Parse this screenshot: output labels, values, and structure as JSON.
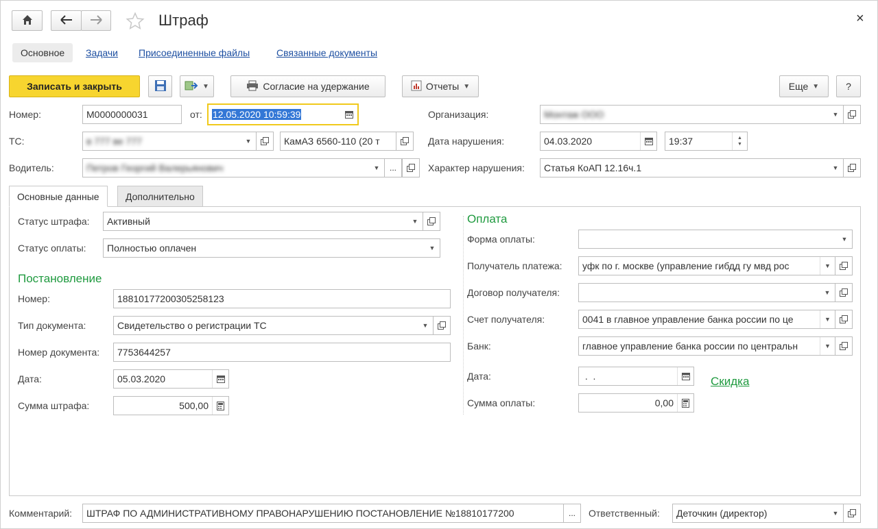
{
  "window": {
    "title": "Штраф",
    "close_glyph": "×"
  },
  "nav": {
    "home_icon": "home-icon",
    "back_icon": "arrow-left-icon",
    "forward_icon": "arrow-right-icon",
    "star_icon": "star-icon"
  },
  "tabs": [
    {
      "label": "Основное",
      "active": true
    },
    {
      "label": "Задачи"
    },
    {
      "label": "Присоединенные файлы"
    },
    {
      "label": "Связанные документы"
    }
  ],
  "toolbar": {
    "save_close_label": "Записать и закрыть",
    "consent_label": "Согласие на удержание",
    "reports_label": "Отчеты",
    "more_label": "Еще",
    "help_label": "?"
  },
  "header": {
    "number_label": "Номер:",
    "number_value": "М0000000031",
    "from_label": "от:",
    "from_value": "12.05.2020 10:59:39",
    "ts_label": "ТС:",
    "ts_value": "в 777 ве 777",
    "ts_model": "КамАЗ 6560-110 (20 т",
    "driver_label": "Водитель:",
    "driver_value": "Петров Георгий Валерьянович",
    "org_label": "Организация:",
    "org_value": "Монтаж ООО",
    "violation_date_label": "Дата нарушения:",
    "violation_date": "04.03.2020",
    "violation_time": "19:37",
    "violation_kind_label": "Характер нарушения:",
    "violation_kind": "Статья КоАП 12.16ч.1"
  },
  "inner_tabs": [
    {
      "label": "Основные данные",
      "active": true
    },
    {
      "label": "Дополнительно"
    }
  ],
  "left": {
    "fine_status_label": "Статус штрафа:",
    "fine_status": "Активный",
    "pay_status_label": "Статус оплаты:",
    "pay_status": "Полностью оплачен",
    "decision_title": "Постановление",
    "dec_number_label": "Номер:",
    "dec_number": "18810177200305258123",
    "doc_type_label": "Тип документа:",
    "doc_type": "Свидетельство о регистрации ТС",
    "doc_number_label": "Номер документа:",
    "doc_number": "7753644257",
    "date_label": "Дата:",
    "date": "05.03.2020",
    "sum_label": "Сумма штрафа:",
    "sum": "500,00"
  },
  "right": {
    "payment_title": "Оплата",
    "form_label": "Форма оплаты:",
    "form_value": "",
    "recipient_label": "Получатель платежа:",
    "recipient": "уфк по г. москве (управление гибдд гу мвд рос",
    "contract_label": "Договор получателя:",
    "contract": "",
    "account_label": "Счет получателя:",
    "account": "0041 в главное управление банка россии по це",
    "bank_label": "Банк:",
    "bank": "главное управление банка россии по центральн",
    "date_label": "Дата:",
    "date": " .  .",
    "discount_link": "Скидка",
    "sum_label": "Сумма оплаты:",
    "sum": "0,00"
  },
  "footer": {
    "comment_label": "Комментарий:",
    "comment": "ШТРАФ ПО АДМИНИСТРАТИВНОМУ ПРАВОНАРУШЕНИЮ ПОСТАНОВЛЕНИЕ №18810177200",
    "responsible_label": "Ответственный:",
    "responsible": "Деточкин (директор)",
    "ellipsis": "..."
  },
  "colors": {
    "primary_button": "#f7d52f",
    "link": "#1d4fa1",
    "section_green": "#1f9a3f",
    "selection": "#3377d6"
  }
}
